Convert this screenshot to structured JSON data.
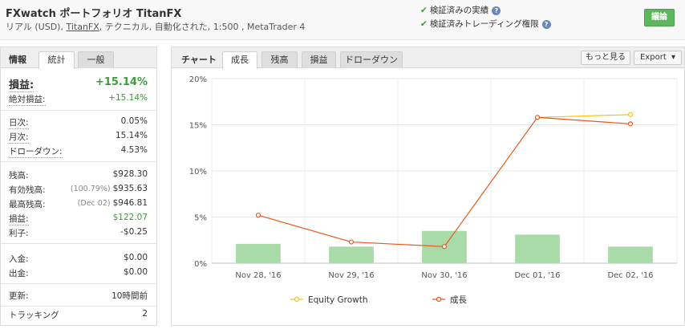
{
  "header": {
    "title": "FXwatch ポートフォリオ TitanFX",
    "subtitle_prefix": "リアル (USD), ",
    "broker_link": "TitanFX",
    "subtitle_suffix": ", テクニカル, 自動化された, 1:500 , MetaTrader 4",
    "verified_track_record": "検証済みの実績",
    "verified_trading_privileges": "検証済みトレーディング権限",
    "help_glyph": "?",
    "discuss_button": "議論"
  },
  "left_panel": {
    "label": "情報",
    "tabs": [
      "統計",
      "一般"
    ],
    "stats": {
      "gain_label": "損益:",
      "gain_value": "+15.14%",
      "abs_gain_label": "絶対損益:",
      "abs_gain_value": "+15.14%",
      "daily_label": "日次:",
      "daily_value": "0.05%",
      "monthly_label": "月次:",
      "monthly_value": "15.14%",
      "drawdown_label": "ドローダウン:",
      "drawdown_value": "4.53%",
      "balance_label": "残高:",
      "balance_value": "$928.30",
      "equity_label": "有効残高:",
      "equity_note": "(100.79%)",
      "equity_value": "$935.63",
      "highest_label": "最高残高:",
      "highest_note": "(Dec 02)",
      "highest_value": "$946.81",
      "profit_label": "損益:",
      "profit_value": "$122.07",
      "interest_label": "利子:",
      "interest_value": "-$0.25",
      "deposits_label": "入金:",
      "deposits_value": "$0.00",
      "withdrawals_label": "出金:",
      "withdrawals_value": "$0.00",
      "updated_label": "更新:",
      "updated_value": "10時間前",
      "tracking_label": "トラッキング",
      "tracking_value": "2"
    }
  },
  "right_panel": {
    "label": "チャート",
    "tabs": [
      "成長",
      "残高",
      "損益",
      "ドローダウン"
    ],
    "more_button": "もっと見る",
    "export_button": "Export",
    "chevron_glyph": "▾"
  },
  "colors": {
    "equity_growth": "#f0c419",
    "growth": "#e8561e",
    "bars": "#a8dba8",
    "green_text": "#3b9d3b"
  },
  "chart_data": {
    "type": "line",
    "categories": [
      "Nov 28, '16",
      "Nov 29, '16",
      "Nov 30, '16",
      "Dec 01, '16",
      "Dec 02, '16"
    ],
    "ylim": [
      0,
      20
    ],
    "yticks": [
      "0%",
      "5%",
      "10%",
      "15%",
      "20%"
    ],
    "ytick_values": [
      0,
      5,
      10,
      15,
      20
    ],
    "bars": [
      2.1,
      1.8,
      3.5,
      3.1,
      1.8
    ],
    "series": [
      {
        "name": "Equity Growth",
        "values": [
          null,
          null,
          null,
          15.8,
          16.1
        ]
      },
      {
        "name": "成長",
        "values": [
          5.2,
          2.3,
          1.8,
          15.8,
          15.1
        ]
      }
    ],
    "legend_position": "bottom"
  }
}
